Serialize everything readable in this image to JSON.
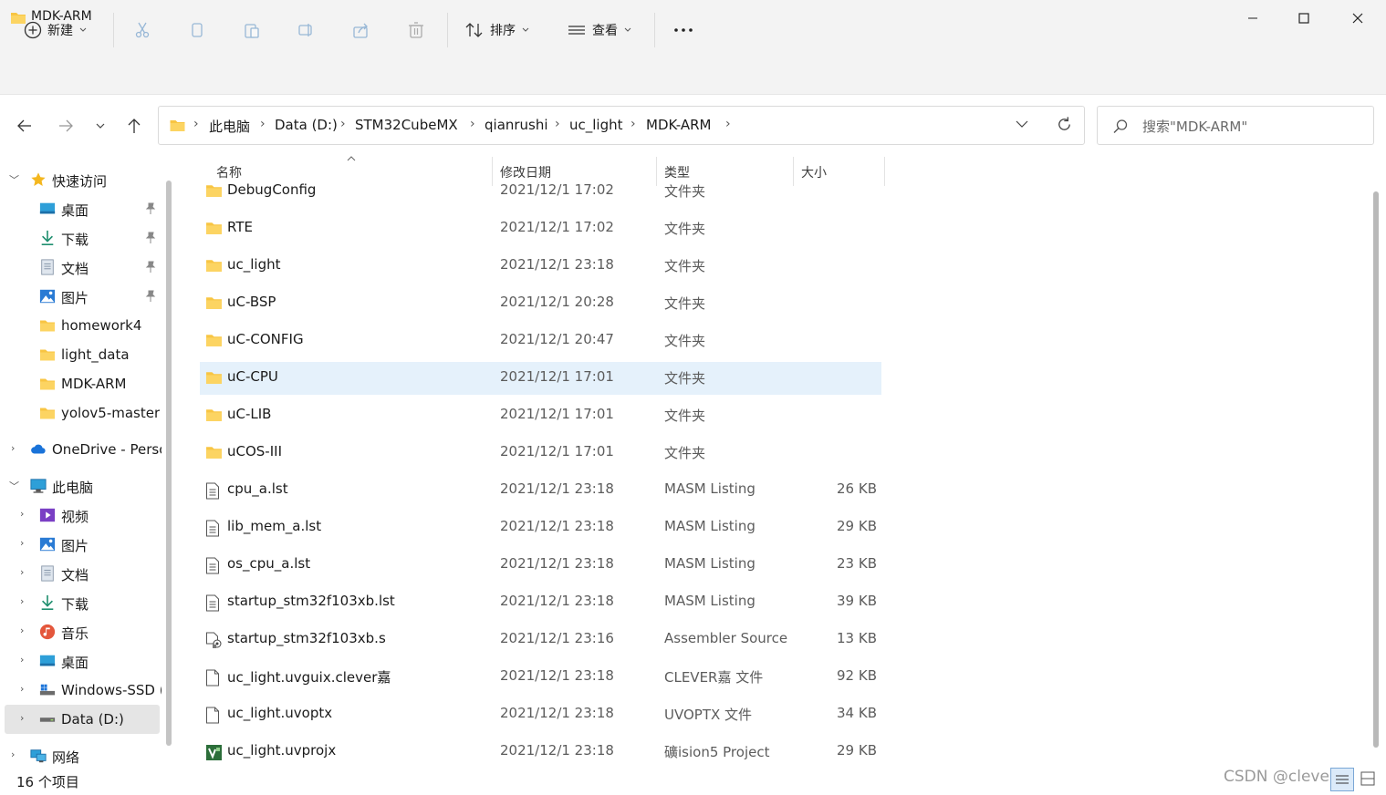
{
  "window": {
    "title": "MDK-ARM"
  },
  "toolbar": {
    "new_label": "新建",
    "sort_label": "排序",
    "view_label": "查看"
  },
  "breadcrumb": [
    "此电脑",
    "Data (D:)",
    "STM32CubeMX",
    "qianrushi",
    "uc_light",
    "MDK-ARM"
  ],
  "search": {
    "placeholder": "搜索\"MDK-ARM\""
  },
  "sidebar": {
    "quick_access": "快速访问",
    "pinned": [
      "桌面",
      "下载",
      "文档",
      "图片"
    ],
    "recent": [
      "homework4",
      "light_data",
      "MDK-ARM",
      "yolov5-master"
    ],
    "onedrive": "OneDrive - Perso",
    "this_pc": "此电脑",
    "pc_items": [
      "视频",
      "图片",
      "文档",
      "下载",
      "音乐",
      "桌面",
      "Windows-SSD (",
      "Data (D:)"
    ],
    "network": "网络"
  },
  "columns": {
    "name": "名称",
    "date": "修改日期",
    "type": "类型",
    "size": "大小"
  },
  "files": [
    {
      "name": "DebugConfig",
      "date": "2021/12/1 17:02",
      "type": "文件夹",
      "size": "",
      "icon": "folder-icon"
    },
    {
      "name": "RTE",
      "date": "2021/12/1 17:02",
      "type": "文件夹",
      "size": "",
      "icon": "folder-icon"
    },
    {
      "name": "uc_light",
      "date": "2021/12/1 23:18",
      "type": "文件夹",
      "size": "",
      "icon": "folder-icon"
    },
    {
      "name": "uC-BSP",
      "date": "2021/12/1 20:28",
      "type": "文件夹",
      "size": "",
      "icon": "folder-icon"
    },
    {
      "name": "uC-CONFIG",
      "date": "2021/12/1 20:47",
      "type": "文件夹",
      "size": "",
      "icon": "folder-icon"
    },
    {
      "name": "uC-CPU",
      "date": "2021/12/1 17:01",
      "type": "文件夹",
      "size": "",
      "icon": "folder-icon"
    },
    {
      "name": "uC-LIB",
      "date": "2021/12/1 17:01",
      "type": "文件夹",
      "size": "",
      "icon": "folder-icon"
    },
    {
      "name": "uCOS-III",
      "date": "2021/12/1 17:01",
      "type": "文件夹",
      "size": "",
      "icon": "folder-icon"
    },
    {
      "name": "cpu_a.lst",
      "date": "2021/12/1 23:18",
      "type": "MASM Listing",
      "size": "26 KB",
      "icon": "listing-file-icon"
    },
    {
      "name": "lib_mem_a.lst",
      "date": "2021/12/1 23:18",
      "type": "MASM Listing",
      "size": "29 KB",
      "icon": "listing-file-icon"
    },
    {
      "name": "os_cpu_a.lst",
      "date": "2021/12/1 23:18",
      "type": "MASM Listing",
      "size": "23 KB",
      "icon": "listing-file-icon"
    },
    {
      "name": "startup_stm32f103xb.lst",
      "date": "2021/12/1 23:18",
      "type": "MASM Listing",
      "size": "39 KB",
      "icon": "listing-file-icon"
    },
    {
      "name": "startup_stm32f103xb.s",
      "date": "2021/12/1 23:16",
      "type": "Assembler Source",
      "size": "13 KB",
      "icon": "assembler-file-icon"
    },
    {
      "name": "uc_light.uvguix.clever嘉",
      "date": "2021/12/1 23:18",
      "type": "CLEVER嘉 文件",
      "size": "92 KB",
      "icon": "blank-file-icon"
    },
    {
      "name": "uc_light.uvoptx",
      "date": "2021/12/1 23:18",
      "type": "UVOPTX 文件",
      "size": "34 KB",
      "icon": "blank-file-icon"
    },
    {
      "name": "uc_light.uvprojx",
      "date": "2021/12/1 23:18",
      "type": "礦ision5 Project",
      "size": "29 KB",
      "icon": "uvision-project-icon"
    }
  ],
  "status": {
    "item_count": "16 个项目"
  },
  "watermark": "CSDN @clevergo",
  "colors": {
    "accent": "#0067c0",
    "selection": "#e5f1fb",
    "folder": "#f8c543"
  }
}
